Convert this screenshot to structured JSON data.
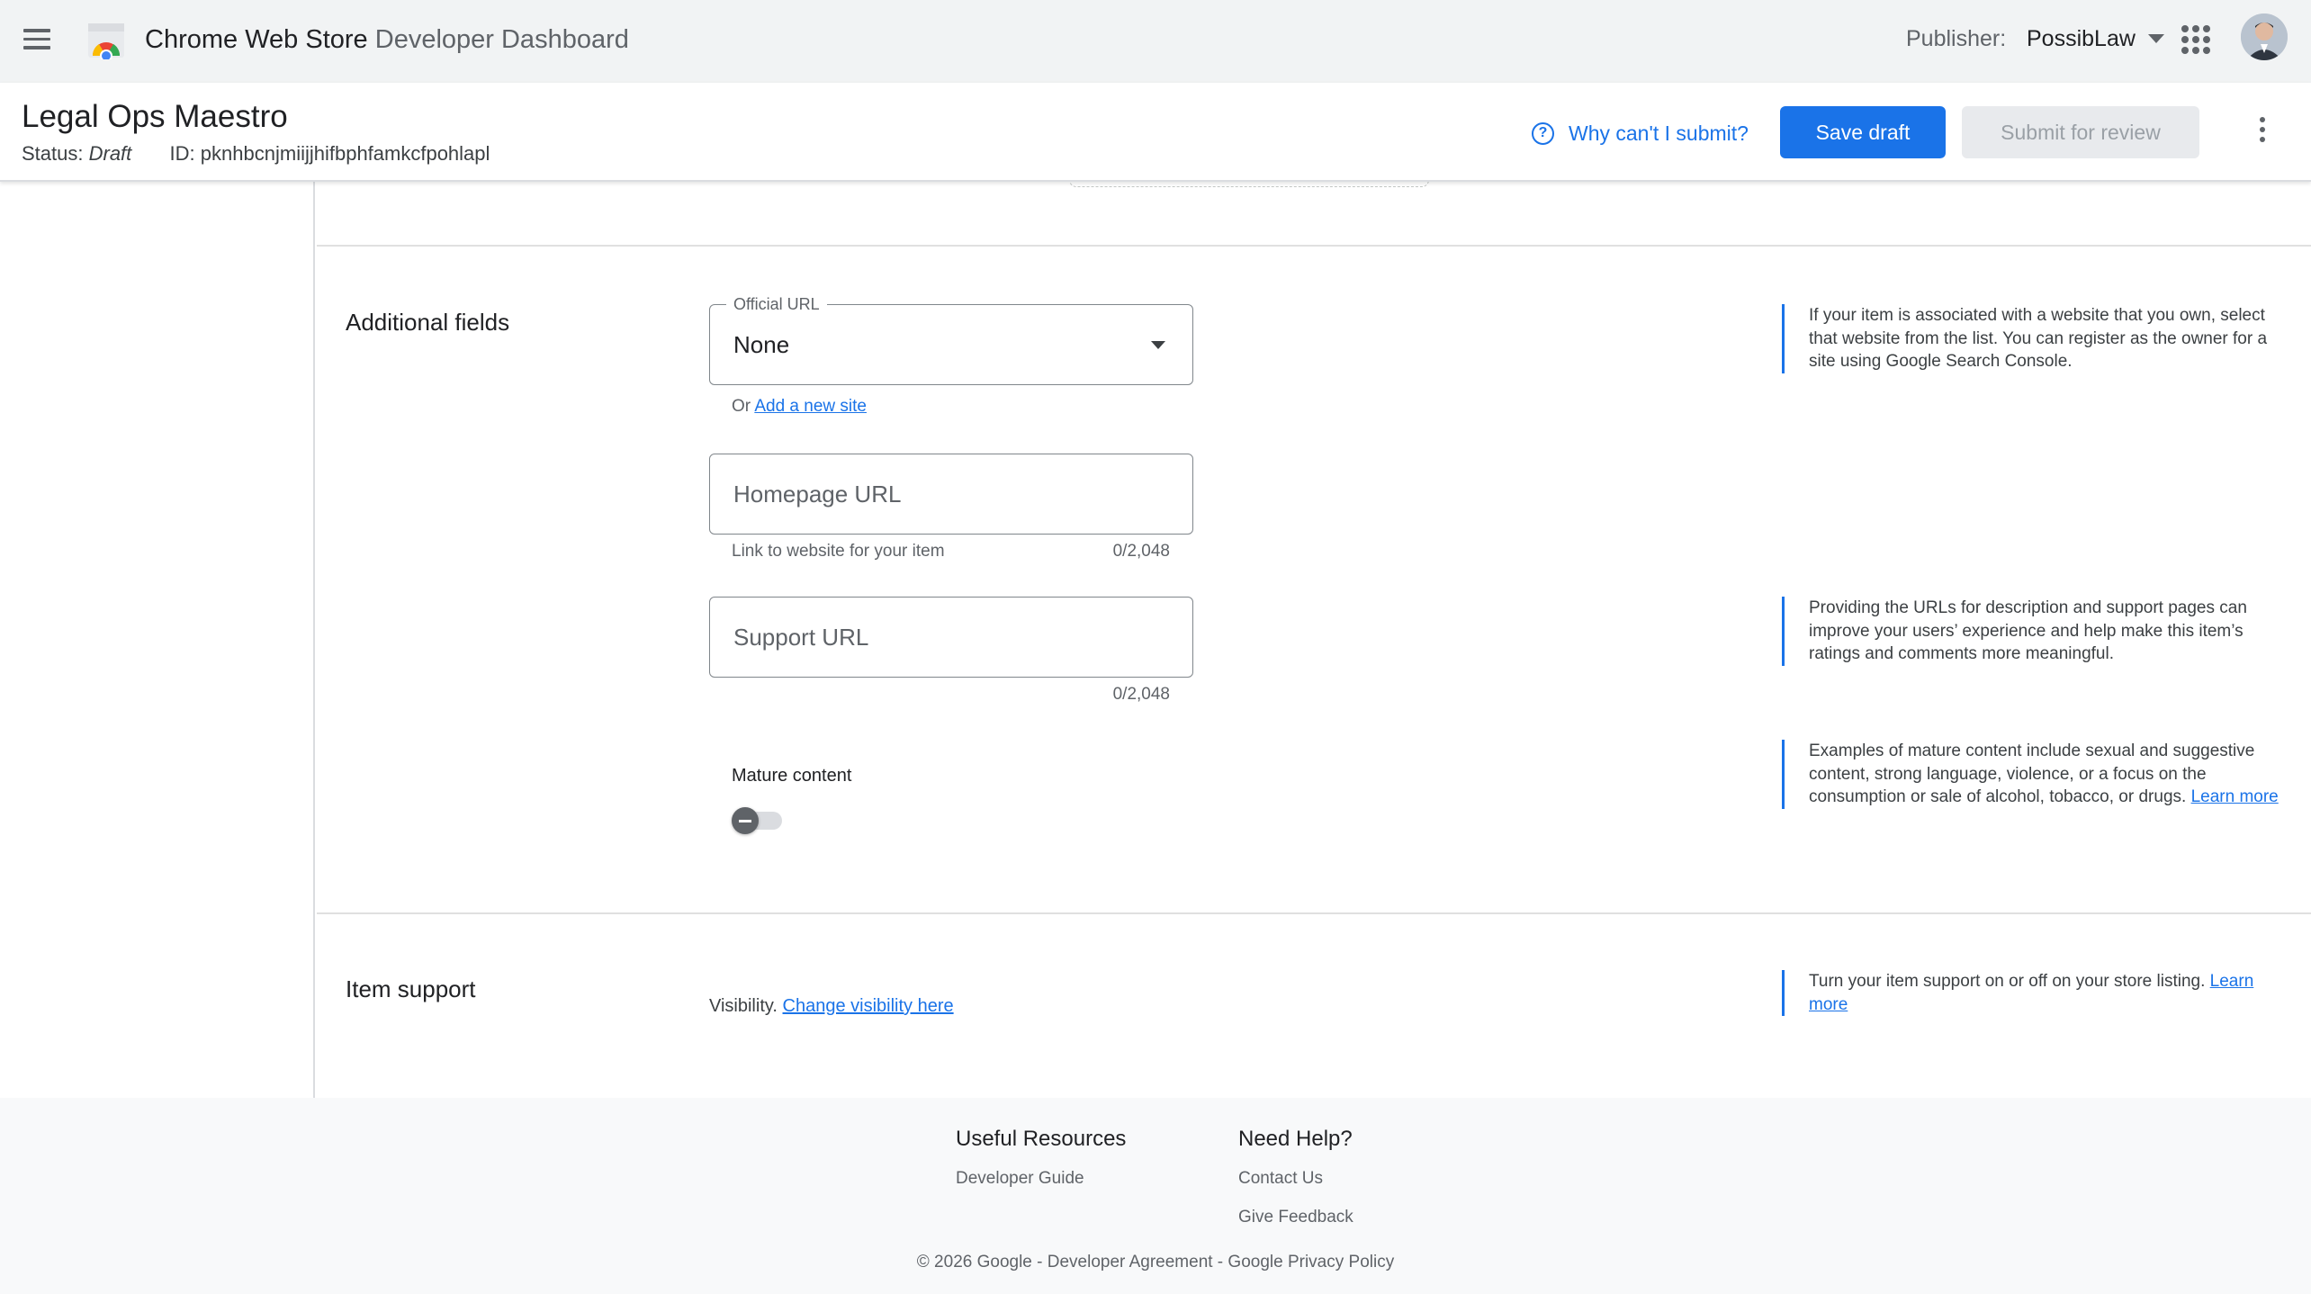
{
  "appbar": {
    "title_main": "Chrome Web Store",
    "title_sub": "Developer Dashboard",
    "publisher_label": "Publisher:",
    "publisher_value": "PossibLaw",
    "icons": [
      "menu-icon",
      "chrome-web-store-logo",
      "caret-down-icon",
      "apps-grid-icon",
      "avatar"
    ]
  },
  "item": {
    "name": "Legal Ops Maestro",
    "status_label": "Status:",
    "status_value": "Draft",
    "id_label": "ID:",
    "id_value": "pknhbcnjmiijjhifbphfamkcfpohlapl",
    "why_link": "Why can't I submit?",
    "save_label": "Save draft",
    "submit_label": "Submit for review",
    "accent_color": "#1a73e8"
  },
  "additional": {
    "title": "Additional fields",
    "official_url": {
      "label": "Official URL",
      "value": "None",
      "hint_prefix": "Or",
      "hint_link": "Add a new site"
    },
    "official_note": "If your item is associated with a website that you own, select that website from the list. You can register as the owner for a site using Google Search Console.",
    "homepage_url": {
      "placeholder": "Homepage URL",
      "helper": "Link to website for your item",
      "counter": "0/2,048"
    },
    "support_url": {
      "placeholder": "Support URL",
      "counter": "0/2,048"
    },
    "support_note": "Providing the URLs for description and support pages can improve your users’ experience and help make this item’s ratings and comments more meaningful.",
    "mature": {
      "label": "Mature content",
      "enabled": false
    },
    "mature_note_text": "Examples of mature content include sexual and suggestive content, strong language, violence, or a focus on the consumption or sale of alcohol, tobacco, or drugs.",
    "mature_note_link": "Learn more"
  },
  "item_support": {
    "title": "Item support",
    "visibility_label": "Visibility.",
    "visibility_link": "Change visibility here",
    "note_text": "Turn your item support on or off on your store listing.",
    "note_link": "Learn more"
  },
  "footer": {
    "col1_title": "Useful Resources",
    "col1_links": [
      "Developer Guide"
    ],
    "col2_title": "Need Help?",
    "col2_links": [
      "Contact Us",
      "Give Feedback"
    ],
    "copyright": "© 2026 Google - Developer Agreement - Google Privacy Policy"
  }
}
